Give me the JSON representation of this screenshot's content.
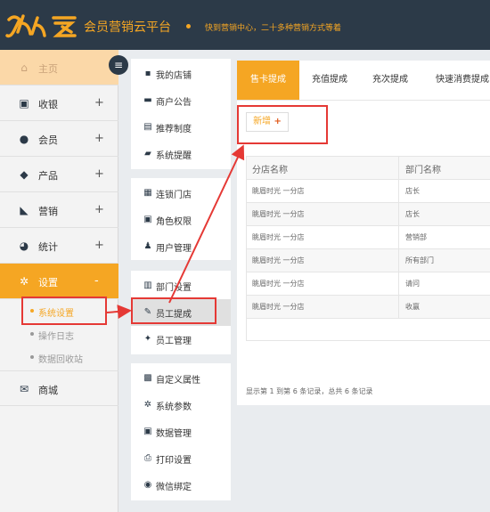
{
  "header": {
    "logo_text": "久久客",
    "app_title": "会员营销云平台",
    "slogan": "快到营销中心，二十多种营销方式等着"
  },
  "sidebar": {
    "items": [
      {
        "label": "主页",
        "icon": "home-icon",
        "has_plus": false
      },
      {
        "label": "收银",
        "icon": "monitor-icon",
        "has_plus": true
      },
      {
        "label": "会员",
        "icon": "user-icon",
        "has_plus": true
      },
      {
        "label": "产品",
        "icon": "box-icon",
        "has_plus": true
      },
      {
        "label": "营销",
        "icon": "tag-icon",
        "has_plus": true
      },
      {
        "label": "统计",
        "icon": "pie-chart-icon",
        "has_plus": true
      },
      {
        "label": "设置",
        "icon": "gear-icon",
        "has_plus": true,
        "expanded_symbol": "-"
      },
      {
        "label": "商城",
        "icon": "mail-icon",
        "has_plus": false
      }
    ],
    "settings_sub": [
      {
        "label": "系统设置",
        "active": true
      },
      {
        "label": "操作日志",
        "active": false
      },
      {
        "label": "数据回收站",
        "active": false
      }
    ]
  },
  "menu": {
    "group1": [
      "我的店铺",
      "商户公告",
      "推荐制度",
      "系统提醒"
    ],
    "group2": [
      "连锁门店",
      "角色权限",
      "用户管理"
    ],
    "group3": [
      "部门设置",
      "员工提成",
      "员工管理"
    ],
    "group4": [
      "自定义属性",
      "系统参数",
      "数据管理",
      "打印设置",
      "微信绑定"
    ]
  },
  "tabs": [
    "售卡提成",
    "充值提成",
    "充次提成",
    "快速消费提成"
  ],
  "main": {
    "add_label": "新增",
    "table": {
      "headers": [
        "分店名称",
        "部门名称"
      ],
      "rows": [
        [
          "眺眉时光 一分店",
          "店长"
        ],
        [
          "眺眉时光 一分店",
          "店长"
        ],
        [
          "眺眉时光 一分店",
          "营销部"
        ],
        [
          "眺眉时光 一分店",
          "所有部门"
        ],
        [
          "眺眉时光 一分店",
          "请问"
        ],
        [
          "眺眉时光 一分店",
          "收赢"
        ]
      ]
    },
    "summary": "显示第 1 到第 6 条记录，总共 6 条记录"
  },
  "colors": {
    "accent": "#f5a623",
    "header_bg": "#2c3a48",
    "annotation": "#e53935"
  }
}
